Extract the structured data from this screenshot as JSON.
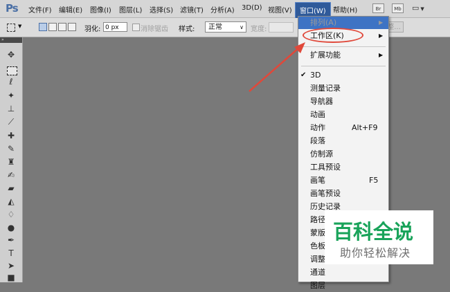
{
  "app": {
    "logo": "Ps"
  },
  "menubar": {
    "items": [
      "文件(F)",
      "编辑(E)",
      "图像(I)",
      "图层(L)",
      "选择(S)",
      "滤镜(T)",
      "分析(A)",
      "3D(D)",
      "视图(V)",
      "窗口(W)",
      "帮助(H)"
    ],
    "active": "窗口(W)",
    "bridge_label": "Br",
    "minibridge_label": "Mb"
  },
  "options_bar": {
    "feather_label": "羽化:",
    "feather_value": "0 px",
    "antialias_label": "消除锯齿",
    "style_label": "样式:",
    "style_value": "正常",
    "width_label": "宽度:",
    "refine_label": "调整..."
  },
  "window_menu": {
    "top_item_partial": "排列(A)",
    "workspace_label": "工作区(K)",
    "extensions_label": "扩展功能",
    "panels": [
      {
        "label": "3D",
        "checked": true,
        "shortcut": ""
      },
      {
        "label": "测量记录",
        "checked": false,
        "shortcut": ""
      },
      {
        "label": "导航器",
        "checked": false,
        "shortcut": ""
      },
      {
        "label": "动画",
        "checked": false,
        "shortcut": ""
      },
      {
        "label": "动作",
        "checked": false,
        "shortcut": "Alt+F9"
      },
      {
        "label": "段落",
        "checked": false,
        "shortcut": ""
      },
      {
        "label": "仿制源",
        "checked": false,
        "shortcut": ""
      },
      {
        "label": "工具预设",
        "checked": false,
        "shortcut": ""
      },
      {
        "label": "画笔",
        "checked": false,
        "shortcut": "F5"
      },
      {
        "label": "画笔预设",
        "checked": false,
        "shortcut": ""
      },
      {
        "label": "历史记录",
        "checked": false,
        "shortcut": ""
      },
      {
        "label": "路径",
        "checked": false,
        "shortcut": ""
      },
      {
        "label": "蒙版",
        "checked": false,
        "shortcut": ""
      },
      {
        "label": "色板",
        "checked": false,
        "shortcut": ""
      },
      {
        "label": "调整",
        "checked": false,
        "shortcut": ""
      },
      {
        "label": "通道",
        "checked": false,
        "shortcut": ""
      },
      {
        "label": "图层",
        "checked": false,
        "shortcut": ""
      }
    ],
    "check_glyph": "✔",
    "arrow_glyph": "▶"
  },
  "watermark": {
    "title": "百科全说",
    "subtitle": "助你轻松解决"
  },
  "colors": {
    "annotation_red": "#e0483a",
    "highlight_blue": "#3e73c4",
    "watermark_green": "#19a35a"
  }
}
